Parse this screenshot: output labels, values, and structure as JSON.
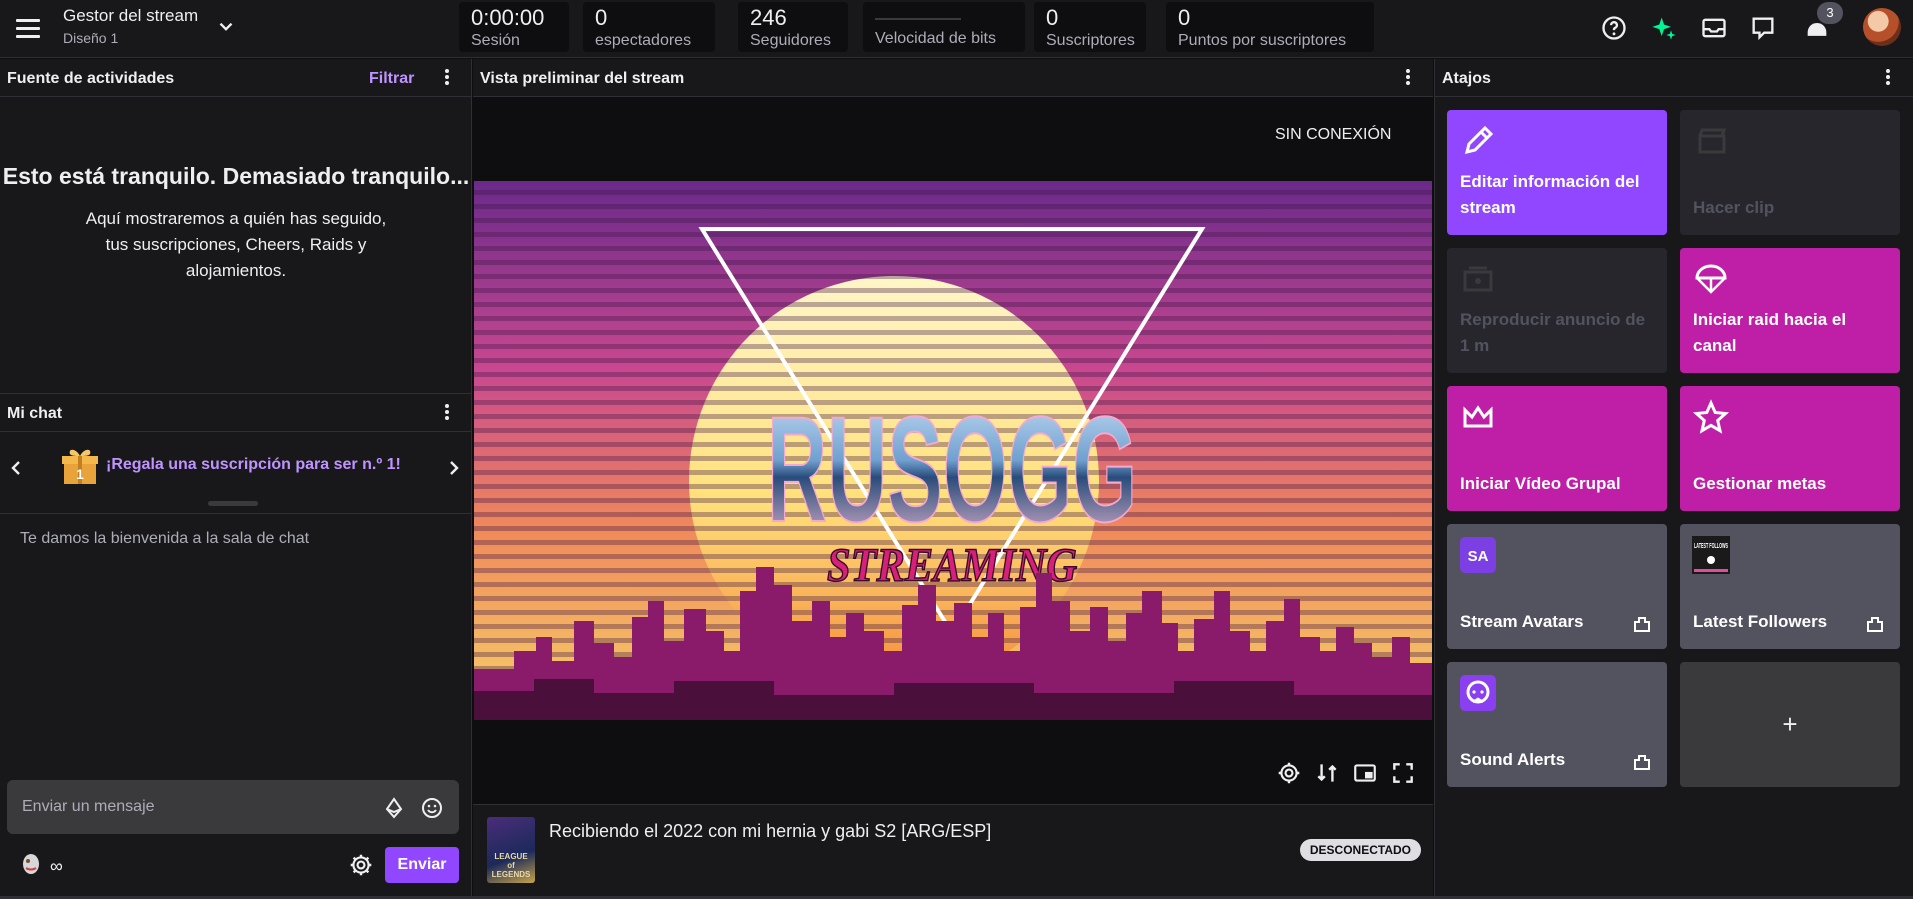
{
  "topbar": {
    "manager_title": "Gestor del stream",
    "layout_name": "Diseño 1",
    "stats": [
      {
        "value": "0:00:00",
        "label": "Sesión"
      },
      {
        "value": "0",
        "label": "espectadores"
      },
      {
        "value": "246",
        "label": "Seguidores"
      },
      {
        "value": "",
        "label": "Velocidad de bits"
      },
      {
        "value": "0",
        "label": "Suscriptores"
      },
      {
        "value": "0",
        "label": "Puntos por suscriptores"
      }
    ],
    "notification_count": "3",
    "icons": [
      "help-icon",
      "sparkle-icon",
      "inbox-icon",
      "whispers-icon",
      "notifications-icon"
    ]
  },
  "activity": {
    "title": "Fuente de actividades",
    "filter_label": "Filtrar",
    "empty_title": "Esto está tranquilo. Demasiado tranquilo...",
    "empty_text": "Aquí mostraremos a quién has seguido, tus suscripciones, Cheers, Raids y alojamientos."
  },
  "chat": {
    "title": "Mi chat",
    "gift_text": "¡Regala una suscripción para ser n.º 1!",
    "gift_rank": "1",
    "welcome": "Te damos la bienvenida a la sala de chat",
    "input_placeholder": "Enviar un mensaje",
    "points": "∞",
    "send_label": "Enviar"
  },
  "preview": {
    "title": "Vista preliminar del stream",
    "offline_label": "SIN CONEXIÓN",
    "art_title": "RUSOGG",
    "art_subtitle": "STREAMING",
    "stream_title": "Recibiendo el 2022 con mi hernia y gabi S2 [ARG/ESP]",
    "game_box_text": "LEAGUE of LEGENDS",
    "status_badge": "DESCONECTADO",
    "controls": [
      "settings-icon",
      "swap-icon",
      "picture-in-picture-icon",
      "fullscreen-icon"
    ]
  },
  "shortcuts": {
    "title": "Atajos",
    "tiles": [
      {
        "label": "Editar información del stream",
        "style": "purple",
        "icon": "pencil-icon"
      },
      {
        "label": "Hacer clip",
        "style": "dim",
        "icon": "clapperboard-icon"
      },
      {
        "label": "Reproducir anuncio de 1 m",
        "style": "dim",
        "icon": "ad-icon"
      },
      {
        "label": "Iniciar raid hacia el canal",
        "style": "magenta",
        "icon": "parachute-icon"
      },
      {
        "label": "Iniciar Vídeo Grupal",
        "style": "magenta",
        "icon": "crown-icon"
      },
      {
        "label": "Gestionar metas",
        "style": "magenta",
        "icon": "star-icon"
      },
      {
        "label": "Stream Avatars",
        "style": "grey",
        "icon": "stream-avatars-icon",
        "icon_text": "SA"
      },
      {
        "label": "Latest Followers",
        "style": "grey",
        "icon": "latest-followers-icon",
        "icon_text": "LATEST FOLLOWS"
      },
      {
        "label": "Sound Alerts",
        "style": "grey",
        "icon": "sound-alerts-icon"
      },
      {
        "label": "+",
        "style": "darkgrey",
        "icon": "plus-icon"
      }
    ]
  },
  "colors": {
    "accent_purple": "#9147ff",
    "magenta": "#bf1ea6",
    "link_purple": "#bf94ff",
    "background": "#0e0e10",
    "panel": "#18181b"
  }
}
